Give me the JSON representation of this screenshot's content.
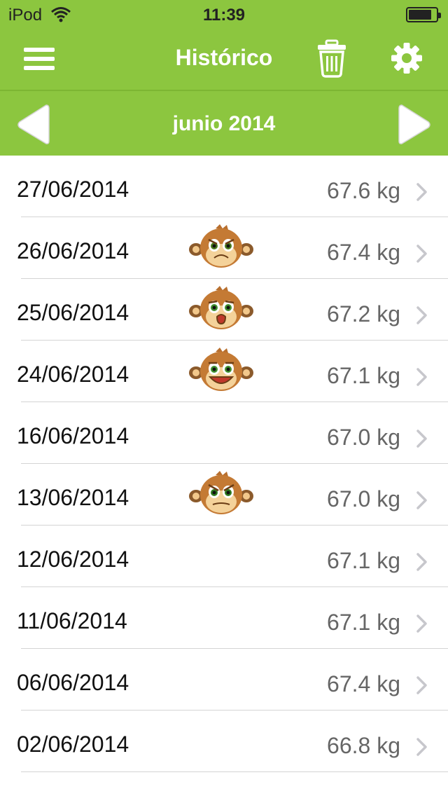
{
  "status_bar": {
    "carrier": "iPod",
    "time": "11:39"
  },
  "header": {
    "title": "Histórico"
  },
  "month_nav": {
    "label": "junio 2014"
  },
  "entries": [
    {
      "date": "27/06/2014",
      "weight": "67.6 kg",
      "mood": null
    },
    {
      "date": "26/06/2014",
      "weight": "67.4 kg",
      "mood": "sad"
    },
    {
      "date": "25/06/2014",
      "weight": "67.2 kg",
      "mood": "surprised"
    },
    {
      "date": "24/06/2014",
      "weight": "67.1 kg",
      "mood": "happy"
    },
    {
      "date": "16/06/2014",
      "weight": "67.0 kg",
      "mood": null
    },
    {
      "date": "13/06/2014",
      "weight": "67.0 kg",
      "mood": "angry"
    },
    {
      "date": "12/06/2014",
      "weight": "67.1 kg",
      "mood": null
    },
    {
      "date": "11/06/2014",
      "weight": "67.1 kg",
      "mood": null
    },
    {
      "date": "06/06/2014",
      "weight": "67.4 kg",
      "mood": null
    },
    {
      "date": "02/06/2014",
      "weight": "66.8 kg",
      "mood": null
    }
  ],
  "colors": {
    "accent": "#8cc63f",
    "text": "#111111",
    "weight_text": "#666666",
    "separator": "#d4d4d4",
    "chevron": "#c7c7cc"
  },
  "icons": [
    "menu-icon",
    "trash-icon",
    "gear-icon",
    "arrow-left-icon",
    "arrow-right-icon",
    "chevron-right-icon",
    "monkey-face-icon"
  ]
}
